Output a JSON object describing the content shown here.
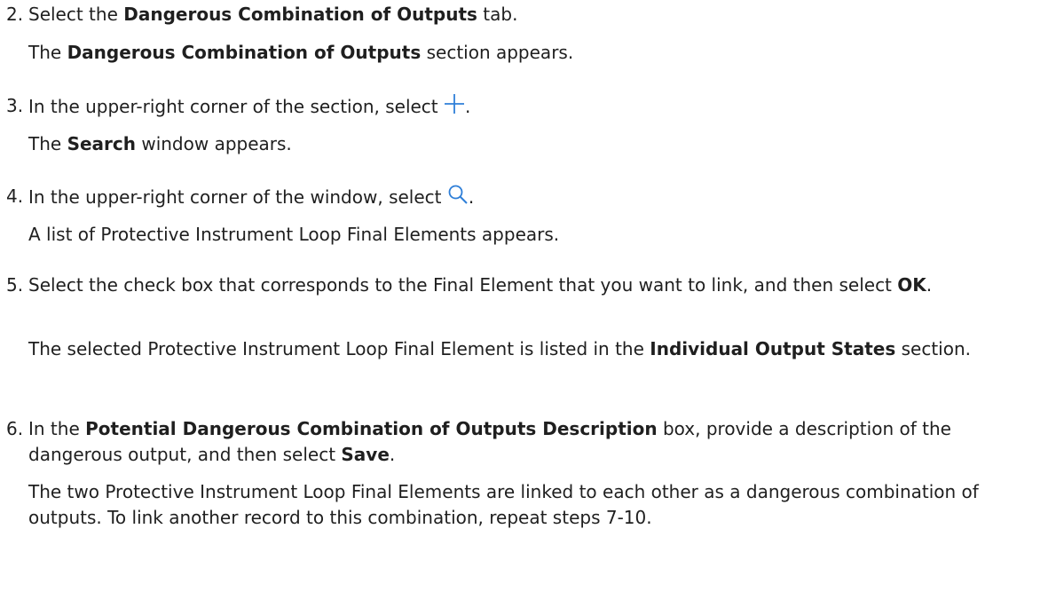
{
  "steps": [
    {
      "number": "2.",
      "instruction": {
        "t1": "Select the ",
        "b1": "Dangerous Combination of Outputs",
        "t2": " tab."
      },
      "result": {
        "t1": "The ",
        "b1": "Dangerous Combination of Outputs",
        "t2": " section appears."
      }
    },
    {
      "number": "3.",
      "instruction": {
        "t1": "In the upper-right corner of the section, select ",
        "icon": "plus-icon",
        "t2": "."
      },
      "result": {
        "t1": "The ",
        "b1": "Search",
        "t2": " window appears."
      }
    },
    {
      "number": "4.",
      "instruction": {
        "t1": "In the upper-right corner of the window, select ",
        "icon": "search-icon",
        "t2": "."
      },
      "result": {
        "t1": "A list of Protective Instrument Loop Final Elements appears."
      }
    },
    {
      "number": "5.",
      "instruction": {
        "t1": "Select the check box that corresponds to the Final Element that you want to link, and then select ",
        "b1": "OK",
        "t2": "."
      },
      "result": {
        "t1": "The selected Protective Instrument Loop Final Element is listed in the ",
        "b1": "Individual Output States",
        "t2": " section."
      }
    },
    {
      "number": "6.",
      "instruction": {
        "t1": "In the ",
        "b1": "Potential Dangerous Combination of Outputs Description",
        "t2": " box, provide a description of the dangerous output, and then select ",
        "b2": "Save",
        "t3": "."
      },
      "result": {
        "t1": "The two Protective Instrument Loop Final Elements are linked to each other as a dangerous combination of outputs. To link another record to this combination, repeat steps 7-10."
      }
    }
  ],
  "icon_color": "#2f7fd8",
  "text_color": "#1f1f1f"
}
